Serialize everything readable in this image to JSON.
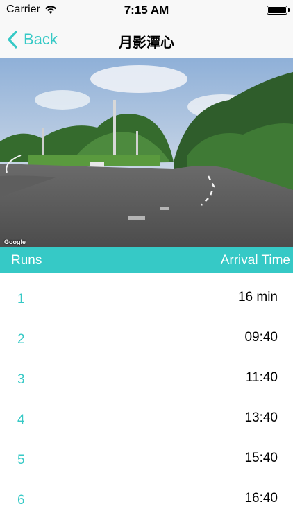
{
  "status_bar": {
    "carrier": "Carrier",
    "time": "7:15 AM",
    "icons": [
      "wifi-icon",
      "battery-icon"
    ]
  },
  "nav": {
    "back_label": "Back",
    "title": "月影潭心"
  },
  "photo": {
    "watermark": "Google"
  },
  "table": {
    "header": {
      "runs": "Runs",
      "arrival_time": "Arrival Time"
    },
    "rows": [
      {
        "run": "1",
        "time": "16 min"
      },
      {
        "run": "2",
        "time": "09:40"
      },
      {
        "run": "3",
        "time": "11:40"
      },
      {
        "run": "4",
        "time": "13:40"
      },
      {
        "run": "5",
        "time": "15:40"
      },
      {
        "run": "6",
        "time": "16:40"
      }
    ]
  },
  "colors": {
    "accent": "#36c9c6",
    "bar_background": "#f8f8f8",
    "text": "#000000"
  }
}
